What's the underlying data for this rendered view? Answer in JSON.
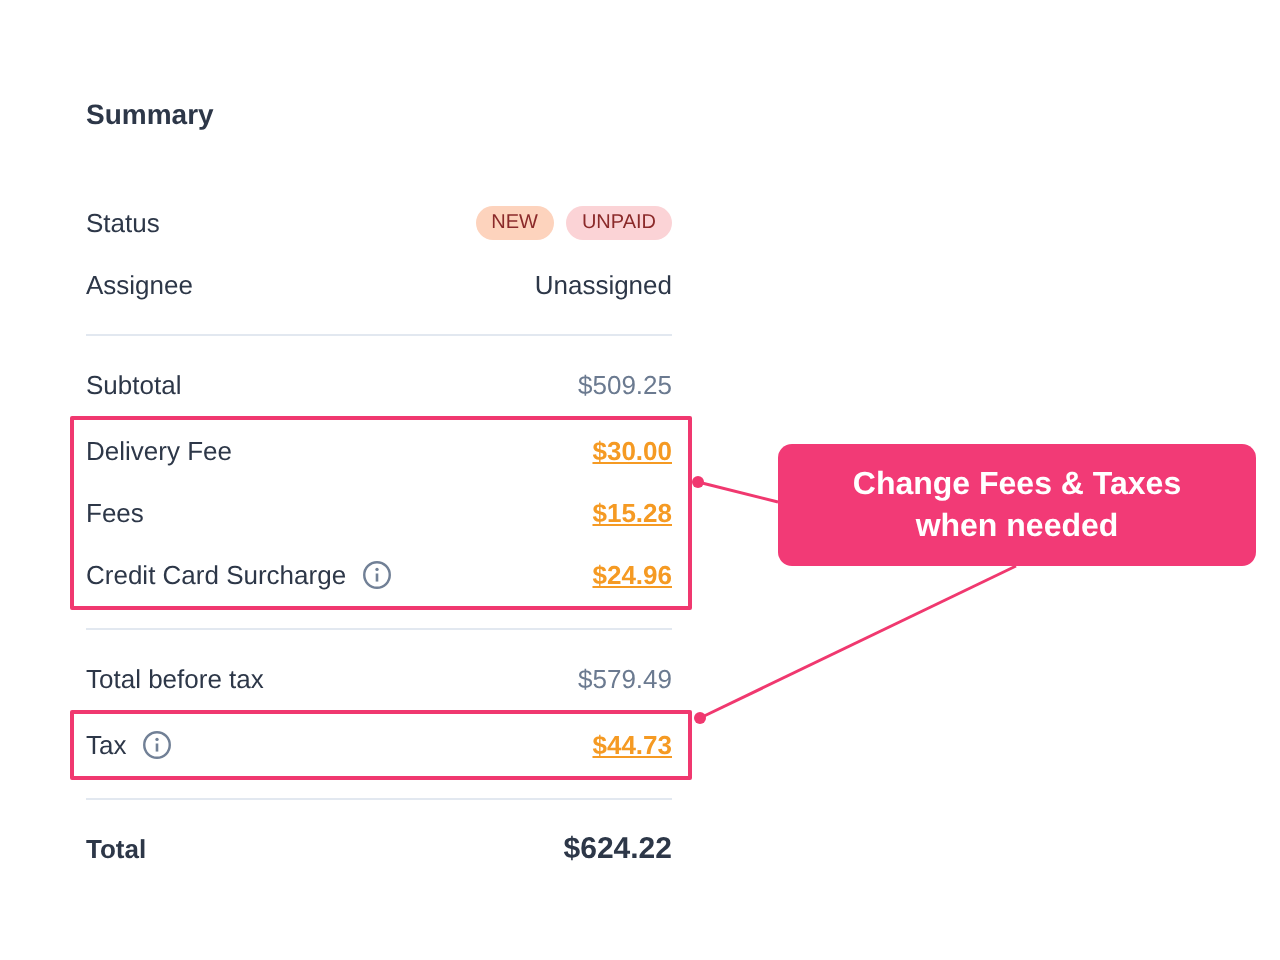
{
  "title": "Summary",
  "sections": [
    {
      "blocks": [
        {
          "highlighted": false,
          "rows": [
            {
              "kind": "badges",
              "label": "Status",
              "badges": [
                {
                  "text": "NEW",
                  "color": "#fdd3bd"
                },
                {
                  "text": "UNPAID",
                  "color": "#fbd3d6"
                }
              ]
            },
            {
              "kind": "plain",
              "label": "Assignee",
              "value": "Unassigned"
            }
          ]
        }
      ]
    },
    {
      "blocks": [
        {
          "highlighted": false,
          "rows": [
            {
              "kind": "muted",
              "label": "Subtotal",
              "value": "$509.25"
            }
          ]
        },
        {
          "highlighted": true,
          "rows": [
            {
              "kind": "editable",
              "label": "Delivery Fee",
              "value": "$30.00",
              "info": false
            },
            {
              "kind": "editable",
              "label": "Fees",
              "value": "$15.28",
              "info": false
            },
            {
              "kind": "editable",
              "label": "Credit Card Surcharge",
              "value": "$24.96",
              "info": true
            }
          ]
        }
      ]
    },
    {
      "blocks": [
        {
          "highlighted": false,
          "rows": [
            {
              "kind": "muted",
              "label": "Total before tax",
              "value": "$579.49"
            }
          ]
        },
        {
          "highlighted": true,
          "rows": [
            {
              "kind": "editable",
              "label": "Tax",
              "value": "$44.73",
              "info": true
            }
          ]
        }
      ]
    },
    {
      "blocks": [
        {
          "highlighted": false,
          "rows": [
            {
              "kind": "total",
              "label": "Total",
              "value": "$624.22"
            }
          ]
        }
      ]
    }
  ],
  "callout": {
    "text": "Change Fees & Taxes when needed"
  }
}
